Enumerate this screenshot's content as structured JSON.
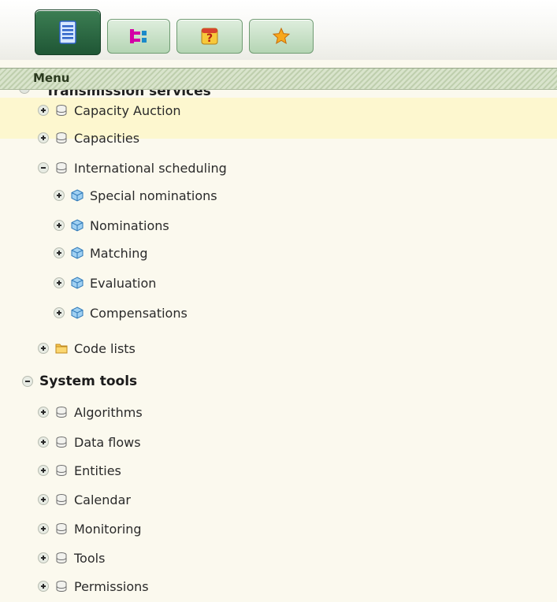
{
  "toolbar": {
    "buttons": [
      {
        "name": "menu-view",
        "icon": "list-icon",
        "active": true
      },
      {
        "name": "tree-view",
        "icon": "tree-icon",
        "active": false
      },
      {
        "name": "help",
        "icon": "help-icon",
        "active": false
      },
      {
        "name": "favorites",
        "icon": "star-icon",
        "active": false
      }
    ]
  },
  "menu": {
    "title": "Menu",
    "cut_group": "Transmission services"
  },
  "tree": [
    {
      "id": "capacity-auction",
      "label": "Capacity Auction",
      "expander": "plus",
      "icon": "database-icon",
      "highlighted": true
    },
    {
      "id": "capacities",
      "label": "Capacities",
      "expander": "plus",
      "icon": "database-icon"
    },
    {
      "id": "international-scheduling",
      "label": "International scheduling",
      "expander": "minus",
      "icon": "database-icon"
    },
    {
      "id": "special-nominations",
      "label": "Special nominations",
      "expander": "plus",
      "icon": "cube-icon"
    },
    {
      "id": "nominations",
      "label": "Nominations",
      "expander": "plus",
      "icon": "cube-icon"
    },
    {
      "id": "matching",
      "label": "Matching",
      "expander": "plus",
      "icon": "cube-icon"
    },
    {
      "id": "evaluation",
      "label": "Evaluation",
      "expander": "plus",
      "icon": "cube-icon"
    },
    {
      "id": "compensations",
      "label": "Compensations",
      "expander": "plus",
      "icon": "cube-icon"
    },
    {
      "id": "code-lists",
      "label": "Code lists",
      "expander": "plus",
      "icon": "folder-icon"
    },
    {
      "id": "system-tools",
      "label": "System tools",
      "expander": "minus",
      "icon": "",
      "group": true
    },
    {
      "id": "algorithms",
      "label": "Algorithms",
      "expander": "plus",
      "icon": "database-icon"
    },
    {
      "id": "data-flows",
      "label": "Data flows",
      "expander": "plus",
      "icon": "database-icon"
    },
    {
      "id": "entities",
      "label": "Entities",
      "expander": "plus",
      "icon": "database-icon"
    },
    {
      "id": "calendar",
      "label": "Calendar",
      "expander": "plus",
      "icon": "database-icon"
    },
    {
      "id": "monitoring",
      "label": "Monitoring",
      "expander": "plus",
      "icon": "database-icon"
    },
    {
      "id": "tools",
      "label": "Tools",
      "expander": "plus",
      "icon": "database-icon"
    },
    {
      "id": "permissions",
      "label": "Permissions",
      "expander": "plus",
      "icon": "database-icon"
    }
  ]
}
